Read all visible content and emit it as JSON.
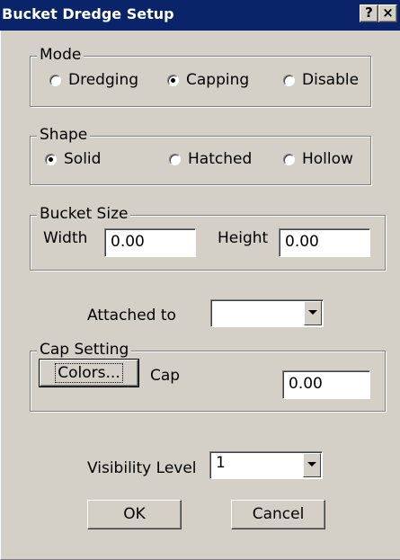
{
  "window": {
    "title": "Bucket Dredge Setup",
    "help_button": "?",
    "close_button": "×"
  },
  "mode": {
    "legend": "Mode",
    "options": [
      {
        "label": "Dredging",
        "selected": false
      },
      {
        "label": "Capping",
        "selected": true
      },
      {
        "label": "Disable",
        "selected": false
      }
    ]
  },
  "shape": {
    "legend": "Shape",
    "options": [
      {
        "label": "Solid",
        "selected": true
      },
      {
        "label": "Hatched",
        "selected": false
      },
      {
        "label": "Hollow",
        "selected": false
      }
    ]
  },
  "bucket_size": {
    "legend": "Bucket Size",
    "width_label": "Width",
    "width_value": "0.00",
    "height_label": "Height",
    "height_value": "0.00"
  },
  "attached": {
    "label": "Attached to",
    "value": ""
  },
  "cap_setting": {
    "legend": "Cap Setting",
    "colors_button": "Colors...",
    "cap_label": "Cap",
    "cap_value": "0.00"
  },
  "visibility": {
    "label": "Visibility Level",
    "value": "1"
  },
  "buttons": {
    "ok": "OK",
    "cancel": "Cancel"
  }
}
